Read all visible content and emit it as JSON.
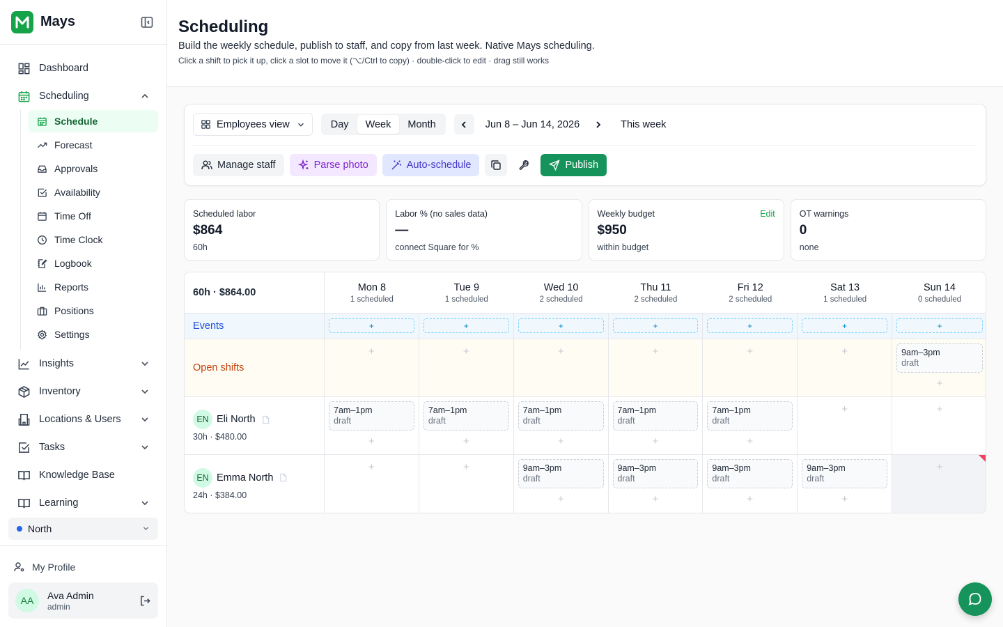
{
  "brand": {
    "name": "Mays",
    "logo_color": "#16a34a"
  },
  "nav": {
    "dashboard": "Dashboard",
    "scheduling": "Scheduling",
    "sub": [
      "Schedule",
      "Forecast",
      "Approvals",
      "Availability",
      "Time Off",
      "Time Clock",
      "Logbook",
      "Reports",
      "Positions",
      "Settings"
    ],
    "insights": "Insights",
    "inventory": "Inventory",
    "locations": "Locations & Users",
    "tasks": "Tasks",
    "knowledge": "Knowledge Base",
    "learning": "Learning"
  },
  "location": {
    "selected": "North",
    "dot_color": "#2563eb"
  },
  "profile": {
    "link": "My Profile",
    "initials": "AA",
    "name": "Ava Admin",
    "role": "admin"
  },
  "page": {
    "title": "Scheduling",
    "subtitle": "Build the weekly schedule, publish to staff, and copy from last week. Native Mays scheduling.",
    "hint": "Click a shift to pick it up, click a slot to move it (⌥/Ctrl to copy) · double-click to edit · drag still works"
  },
  "toolbar": {
    "view": "Employees view",
    "modes": [
      "Day",
      "Week",
      "Month"
    ],
    "active_mode": "Week",
    "date_range": "Jun 8 – Jun 14, 2026",
    "this_week": "This week",
    "manage_staff": "Manage staff",
    "parse_photo": "Parse photo",
    "auto_schedule": "Auto-schedule",
    "publish": "Publish"
  },
  "stats": [
    {
      "label": "Scheduled labor",
      "value": "$864",
      "foot": "60h"
    },
    {
      "label": "Labor % (no sales data)",
      "value": "—",
      "foot": "connect Square for %"
    },
    {
      "label": "Weekly budget",
      "value": "$950",
      "foot": "within budget",
      "action": "Edit"
    },
    {
      "label": "OT warnings",
      "value": "0",
      "foot": "none"
    }
  ],
  "grid": {
    "summary": "60h · $864.00",
    "days": [
      {
        "name": "Mon 8",
        "count": "1 scheduled"
      },
      {
        "name": "Tue 9",
        "count": "1 scheduled"
      },
      {
        "name": "Wed 10",
        "count": "2 scheduled"
      },
      {
        "name": "Thu 11",
        "count": "2 scheduled"
      },
      {
        "name": "Fri 12",
        "count": "2 scheduled"
      },
      {
        "name": "Sat 13",
        "count": "1 scheduled"
      },
      {
        "name": "Sun 14",
        "count": "0 scheduled"
      }
    ],
    "events_label": "Events",
    "open_label": "Open shifts",
    "open_shifts": [
      null,
      null,
      null,
      null,
      null,
      null,
      {
        "time": "9am–3pm",
        "status": "draft"
      }
    ],
    "employees": [
      {
        "initials": "EN",
        "name": "Eli North",
        "stats": "30h · $480.00",
        "shifts": [
          {
            "time": "7am–1pm",
            "status": "draft"
          },
          {
            "time": "7am–1pm",
            "status": "draft"
          },
          {
            "time": "7am–1pm",
            "status": "draft"
          },
          {
            "time": "7am–1pm",
            "status": "draft"
          },
          {
            "time": "7am–1pm",
            "status": "draft"
          },
          null,
          null
        ]
      },
      {
        "initials": "EN",
        "name": "Emma North",
        "stats": "24h · $384.00",
        "shifts": [
          null,
          null,
          {
            "time": "9am–3pm",
            "status": "draft"
          },
          {
            "time": "9am–3pm",
            "status": "draft"
          },
          {
            "time": "9am–3pm",
            "status": "draft"
          },
          {
            "time": "9am–3pm",
            "status": "draft"
          },
          null
        ]
      }
    ]
  }
}
